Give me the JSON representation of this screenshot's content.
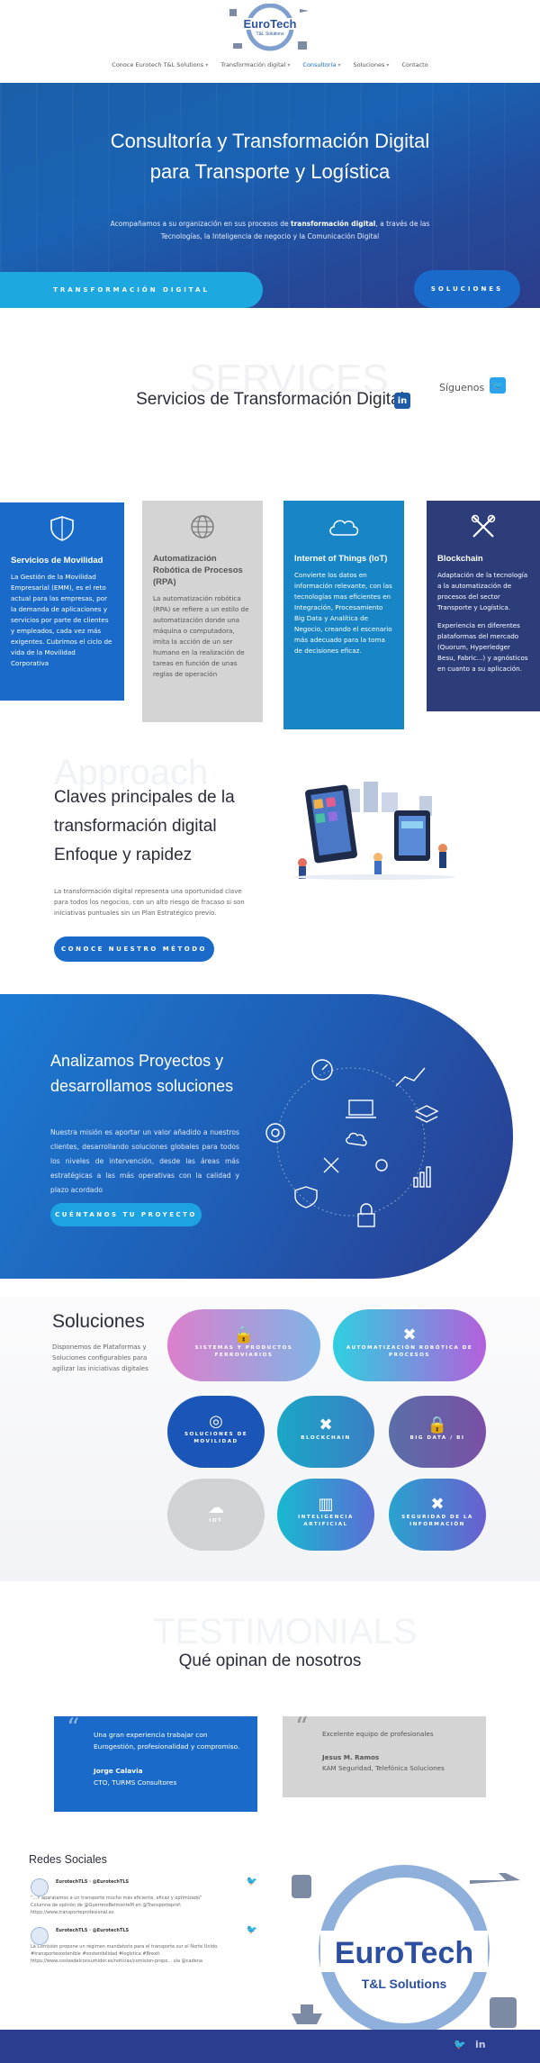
{
  "brand": {
    "name": "EuroTech",
    "tagline": "T&L Solutions"
  },
  "nav": {
    "items": [
      {
        "label": "Conoce Eurotech T&L Solutions",
        "caret": "▾"
      },
      {
        "label": "Transformación digital",
        "caret": "▾"
      },
      {
        "label": "Consultoría",
        "caret": "▾"
      },
      {
        "label": "Soluciones",
        "caret": "▾"
      },
      {
        "label": "Contacto",
        "caret": ""
      }
    ]
  },
  "hero": {
    "title": "Consultoría y Transformación Digital para Transporte y Logística",
    "text_before": "Acompañamos a su organización en sus procesos de ",
    "text_bold": "transformación digital",
    "text_after": ", a través de las Tecnologías, la Inteligencia de negocio y la Comunicación Digital",
    "button_primary": "TRANSFORMACIÓN DIGITAL",
    "button_secondary": "SOLUCIONES"
  },
  "services": {
    "bg_word": "SERVICES",
    "title": "Servicios de Transformación Digital",
    "linkedin_label": "in",
    "follow_label": "Síguenos",
    "twitter_label": "🐦",
    "cards": [
      {
        "title": "Servicios de Movilidad",
        "text": "La Gestión de la Movilidad Empresarial (EMM), es el reto actual para las empresas, por la demanda de aplicaciones y servicios por parte de clientes y empleados, cada vez más exigentes. Cubrimos el ciclo de vida de la Movilidad Corporativa",
        "icon": "shield-icon"
      },
      {
        "title": "Automatización Robótica de Procesos (RPA)",
        "text": "La automatización robótica (RPA) se refiere a un estilo de automatización donde una máquina o computadora, imita la acción de un ser humano en la realización de tareas en función de unas reglas de operación",
        "icon": "globe-icon"
      },
      {
        "title": "Internet of Things (IoT)",
        "text": "Convierte los datos en información relevante, con las tecnologías mas eficientes en Integración, Procesamiento Big Data y Analítica de Negocio, creando el escenario más adecuado para la toma de decisiones eficaz.",
        "icon": "cloud-icon"
      },
      {
        "title": "Blockchain",
        "text": "Adaptación de la tecnología a la automatización de procesos del sector Transporte y Logística.",
        "text2": "Experiencia en diferentes plataformas del mercado (Quorum, Hyperledger Besu, Fabric...) y agnósticos en cuanto a su aplicación.",
        "icon": "tools-icon"
      }
    ]
  },
  "approach": {
    "bg_word": "Approach",
    "title": "Claves principales de la transformación digital Enfoque y rapidez",
    "text": "La transformación digital representa una oportunidad clave para todos los negocios, con un alto riesgo de fracaso si son iniciativas puntuales sin un Plan Estratégico previo.",
    "button": "CONOCE NUESTRO MÉTODO"
  },
  "analysis": {
    "title": "Analizamos Proyectos y desarrollamos soluciones",
    "text": "Nuestra misión es aportar un valor añadido a nuestros clientes, desarrollando soluciones globales para todos los niveles de intervención, desde las áreas más estratégicas a las más operativas con la calidad y plazo acordado",
    "button": "CUÉNTANOS TU PROYECTO"
  },
  "solutions": {
    "title": "Soluciones",
    "text": "Disponemos de Plataformas y Soluciones configurables para agilizar las iniciativas digitales",
    "items": [
      {
        "label": "SISTEMAS Y PRODUCTOS FERROVIARIOS",
        "icon": "🔒"
      },
      {
        "label": "AUTOMATIZACIÓN ROBÓTICA DE PROCESOS",
        "icon": "✖"
      },
      {
        "label": "SOLUCIONES DE MOVILIDAD",
        "icon": "◎"
      },
      {
        "label": "BLOCKCHAIN",
        "icon": "✖"
      },
      {
        "label": "BIG DATA / BI",
        "icon": "🔒"
      },
      {
        "label": "IOT",
        "icon": "☁"
      },
      {
        "label": "INTELIGENCIA ARTIFICIAL",
        "icon": "▥"
      },
      {
        "label": "SEGURIDAD DE LA INFORMACIÓN",
        "icon": "✖"
      }
    ]
  },
  "testimonials": {
    "bg_word": "TESTIMONIALS",
    "title": "Qué opinan de nosotros",
    "items": [
      {
        "quote": "Una gran experiencia trabajar con Eurogestión, profesionalidad y compromiso.",
        "author": "Jorge Calavia",
        "role": "CTO, TURMS Consultores"
      },
      {
        "quote": "Excelente equipo de profesionales",
        "author": "Jesus M. Ramos",
        "role": "KAM Seguridad, Telefónica Soluciones"
      }
    ]
  },
  "social": {
    "title": "Redes Sociales",
    "tweets": [
      {
        "handle": "EurotechTLS · @EurotechTLS",
        "text": "“...Y aparatamos a un transporte mucho más eficiente, eficaz y optimizado”",
        "extra": "Columna de opinión de @GuerreroBelmonteM en @Transporteprof: https://www.transporteprofesional.es"
      },
      {
        "handle": "EurotechTLS · @EurotechTLS",
        "text": "La Comisión propone un régimen mandatorio para el transporte sur el Norte Unido.",
        "extra": "#transportesostenible #sostenibilidad #logística #Brexit https://www.costesdelconsumidor.es/noticias/comision-propo... vía @cadena"
      }
    ]
  },
  "footer": {
    "twitter": "🐦",
    "linkedin": "in"
  },
  "colors": {
    "primary": "#1a6bc9",
    "accent": "#1da8e0",
    "dark": "#2c3d8a"
  }
}
